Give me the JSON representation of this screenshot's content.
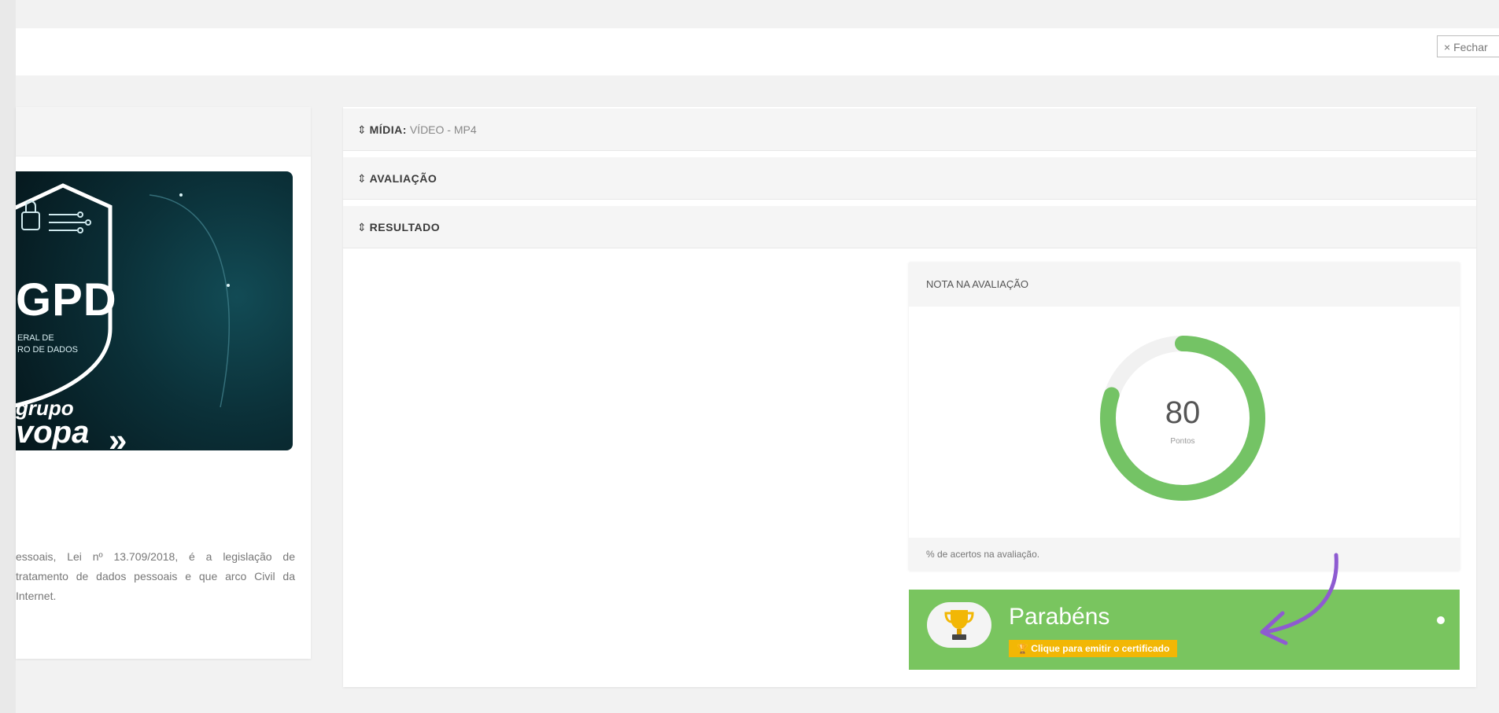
{
  "header": {
    "close_label": "× Fechar"
  },
  "course": {
    "thumbnail": {
      "acronym": "GPD",
      "subtitle_line1": "ERAL DE",
      "subtitle_line2": "RO DE DADOS",
      "brand_line1": "grupo",
      "brand_line2": "vopa",
      "brand_chevron": "»"
    },
    "description": "essoais, Lei nº 13.709/2018, é a legislação de tratamento de dados pessoais e que arco Civil da Internet."
  },
  "accordion": [
    {
      "symbol": "⇕",
      "label": "MÍDIA:",
      "value": " VÍDEO - MP4"
    },
    {
      "symbol": "⇕",
      "label": "AVALIAÇÃO",
      "value": ""
    },
    {
      "symbol": "⇕",
      "label": "RESULTADO",
      "value": ""
    }
  ],
  "score": {
    "heading": "NOTA NA AVALIAÇÃO",
    "value": "80",
    "unit": "Pontos",
    "footer": "% de acertos na avaliação.",
    "fill_fraction": 0.8
  },
  "congrats": {
    "title": "Parabéns",
    "certificate_link": "🏆 Clique para emitir o certificado"
  },
  "colors": {
    "accent_green": "#79c55f",
    "gauge_green": "#74c365",
    "gauge_track": "#f1f1f1",
    "badge_yellow": "#f2b705",
    "arrow_purple": "#8e5bd1",
    "thumb_bg": "#0b3038"
  },
  "icons": {
    "accordion": "sort-icon",
    "trophy": "trophy-icon",
    "arrow": "curved-arrow-icon",
    "shield": "shield-lock-icon"
  }
}
